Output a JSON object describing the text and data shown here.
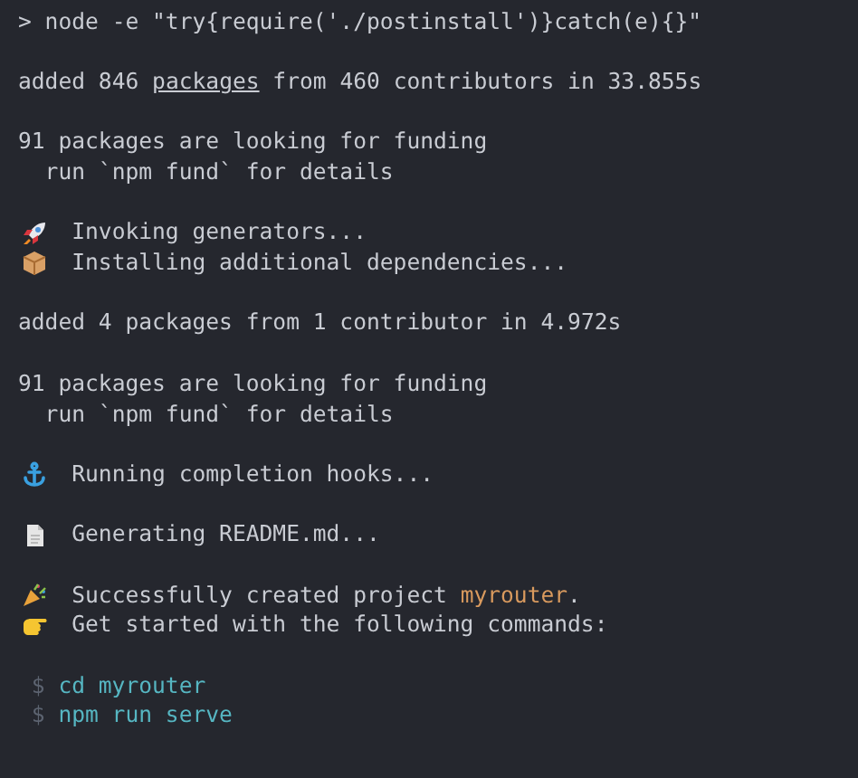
{
  "terminal": {
    "blocks": [
      {
        "lines": [
          {
            "kind": "plain",
            "segments": [
              {
                "text": "> node -e \"try{require('./postinstall')}catch(e){}\""
              }
            ]
          }
        ]
      },
      {
        "lines": [
          {
            "kind": "plain",
            "segments": [
              {
                "text": "added 846 "
              },
              {
                "text": "packages",
                "underline": true
              },
              {
                "text": " from 460 contributors in 33.855s"
              }
            ]
          }
        ]
      },
      {
        "lines": [
          {
            "kind": "plain",
            "segments": [
              {
                "text": "91 packages are looking for funding"
              }
            ]
          },
          {
            "kind": "plain",
            "segments": [
              {
                "text": "  run `npm fund` for details"
              }
            ]
          }
        ]
      },
      {
        "lines": [
          {
            "kind": "rocket",
            "segments": [
              {
                "text": "Invoking generators..."
              }
            ]
          },
          {
            "kind": "package",
            "segments": [
              {
                "text": "Installing additional dependencies..."
              }
            ]
          }
        ]
      },
      {
        "lines": [
          {
            "kind": "plain",
            "segments": [
              {
                "text": "added 4 packages from 1 contributor in 4.972s"
              }
            ]
          }
        ]
      },
      {
        "lines": [
          {
            "kind": "plain",
            "segments": [
              {
                "text": "91 packages are looking for funding"
              }
            ]
          },
          {
            "kind": "plain",
            "segments": [
              {
                "text": "  run `npm fund` for details"
              }
            ]
          }
        ]
      },
      {
        "lines": [
          {
            "kind": "anchor",
            "segments": [
              {
                "text": "Running completion hooks..."
              }
            ]
          }
        ]
      },
      {
        "lines": [
          {
            "kind": "document",
            "segments": [
              {
                "text": "Generating README.md..."
              }
            ]
          }
        ]
      },
      {
        "lines": [
          {
            "kind": "party",
            "segments": [
              {
                "text": "Successfully created project "
              },
              {
                "text": "myrouter",
                "highlight": true
              },
              {
                "text": "."
              }
            ]
          },
          {
            "kind": "pointing",
            "segments": [
              {
                "text": "Get started with the following commands:"
              }
            ]
          }
        ]
      },
      {
        "lines": [
          {
            "kind": "command",
            "prompt": "$",
            "segments": [
              {
                "text": "cd myrouter"
              }
            ]
          },
          {
            "kind": "command",
            "prompt": "$",
            "segments": [
              {
                "text": "npm run serve"
              }
            ]
          }
        ]
      }
    ]
  }
}
